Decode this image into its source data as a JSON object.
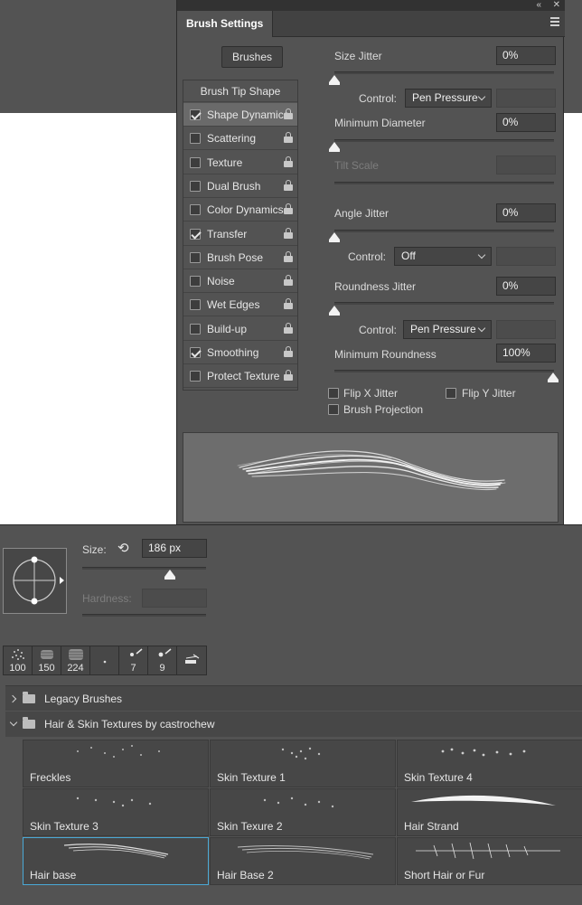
{
  "brush_settings": {
    "tab_title": "Brush Settings",
    "brushes_button": "Brushes",
    "tip_header": "Brush Tip Shape",
    "options": [
      {
        "label": "Shape Dynamics",
        "checked": true,
        "selected": true
      },
      {
        "label": "Scattering",
        "checked": false
      },
      {
        "label": "Texture",
        "checked": false
      },
      {
        "label": "Dual Brush",
        "checked": false
      },
      {
        "label": "Color Dynamics",
        "checked": false
      },
      {
        "label": "Transfer",
        "checked": true
      },
      {
        "label": "Brush Pose",
        "checked": false
      },
      {
        "label": "Noise",
        "checked": false
      },
      {
        "label": "Wet Edges",
        "checked": false
      },
      {
        "label": "Build-up",
        "checked": false
      },
      {
        "label": "Smoothing",
        "checked": true
      },
      {
        "label": "Protect Texture",
        "checked": false
      }
    ],
    "size_jitter": {
      "label": "Size Jitter",
      "value": "0%"
    },
    "size_control": {
      "label": "Control:",
      "value": "Pen Pressure"
    },
    "min_diameter": {
      "label": "Minimum Diameter",
      "value": "0%"
    },
    "tilt_scale": {
      "label": "Tilt Scale"
    },
    "angle_jitter": {
      "label": "Angle Jitter",
      "value": "0%"
    },
    "angle_control": {
      "label": "Control:",
      "value": "Off"
    },
    "roundness_jitter": {
      "label": "Roundness Jitter",
      "value": "0%"
    },
    "roundness_control": {
      "label": "Control:",
      "value": "Pen Pressure"
    },
    "min_roundness": {
      "label": "Minimum Roundness",
      "value": "100%"
    },
    "flip_x": "Flip X Jitter",
    "flip_y": "Flip Y Jitter",
    "brush_projection": "Brush Projection"
  },
  "brush_panel": {
    "size_label": "Size:",
    "size_value": "186 px",
    "hardness_label": "Hardness:",
    "presets": [
      "100",
      "150",
      "224",
      "",
      "7",
      "9",
      ""
    ],
    "groups": [
      {
        "label": "Legacy Brushes",
        "expanded": false
      },
      {
        "label": "Hair & Skin Textures by castrochew",
        "expanded": true
      }
    ],
    "brushes": [
      "Freckles",
      "Skin Texture 1",
      "Skin Texture 4",
      "Skin Texture 3",
      "Skin Texure 2",
      "Hair Strand",
      "Hair base",
      "Hair Base 2",
      "Short Hair or Fur"
    ]
  },
  "colors": {
    "panel": "#535353",
    "accent": "#4aa9d6"
  }
}
